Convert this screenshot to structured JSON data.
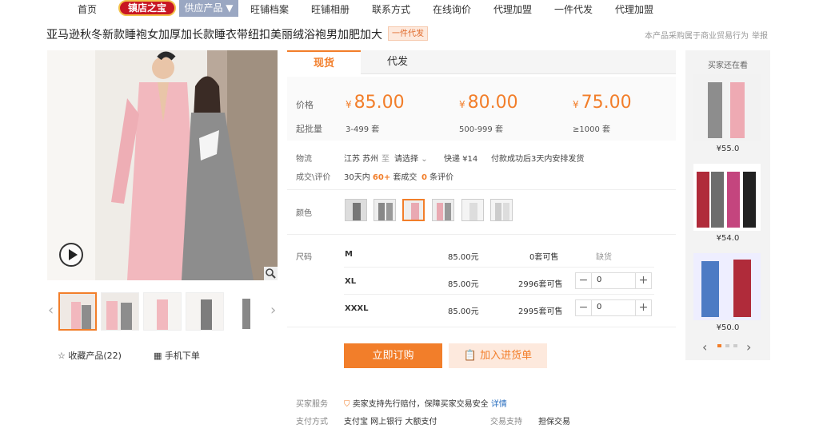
{
  "nav": {
    "home": "首页",
    "shop_badge": "镇店之宝",
    "supply": "供应产品 ▼",
    "archive": "旺铺档案",
    "album": "旺铺相册",
    "contact": "联系方式",
    "inquiry": "在线询价",
    "agent": "代理加盟",
    "dropship": "一件代发",
    "agent2": "代理加盟"
  },
  "product": {
    "title": "亚马逊秋冬新款睡袍女加厚加长款睡衣带纽扣美丽绒浴袍男加肥加大",
    "tag": "一件代发",
    "notice": "本产品采购属于商业贸易行为",
    "report": "举报"
  },
  "gallery": {
    "collect": "收藏产品(22)",
    "mobile": "手机下单"
  },
  "tabs": [
    "现货",
    "代发"
  ],
  "pricing": {
    "price_label": "价格",
    "qty_label": "起批量",
    "currency": "¥",
    "tiers": [
      {
        "price": "85.00",
        "qty": "3-499 套"
      },
      {
        "price": "80.00",
        "qty": "500-999 套"
      },
      {
        "price": "75.00",
        "qty": "≥1000 套"
      }
    ]
  },
  "logistics": {
    "label": "物流",
    "from": "江苏 苏州",
    "to": "至",
    "select": "请选择",
    "express": "快递 ¥14",
    "ship_note": "付款成功后3天内安排发货"
  },
  "deal": {
    "label": "成交\\评价",
    "days": "30天内",
    "count": "60+",
    "deal_suffix": "套成交",
    "reviews": "0",
    "review_suffix": "条评价"
  },
  "color_label": "颜色",
  "size_label": "尺码",
  "sizes": [
    {
      "name": "M",
      "price": "85.00元",
      "stock": "0套可售",
      "status": "缺货"
    },
    {
      "name": "XL",
      "price": "85.00元",
      "stock": "2996套可售",
      "value": "0"
    },
    {
      "name": "XXXL",
      "price": "85.00元",
      "stock": "2995套可售",
      "value": "0"
    }
  ],
  "buttons": {
    "buy": "立即订购",
    "cart": "加入进货单"
  },
  "service": {
    "buyer_label": "买家服务",
    "buyer_text": "卖家支持先行赔付，保障买家交易安全",
    "buyer_link": "详情",
    "pay_label": "支付方式",
    "pay_methods": "支付宝   网上银行   大额支付",
    "trade_label": "交易支持",
    "trade_value": "担保交易"
  },
  "reco": {
    "title": "买家还在看",
    "items": [
      {
        "price": "¥55.0"
      },
      {
        "price": "¥54.0"
      },
      {
        "price": "¥50.0"
      }
    ]
  },
  "colors": {
    "accent": "#f27e2a",
    "badge": "#c81623",
    "nav_active": "#9aa7c2"
  }
}
